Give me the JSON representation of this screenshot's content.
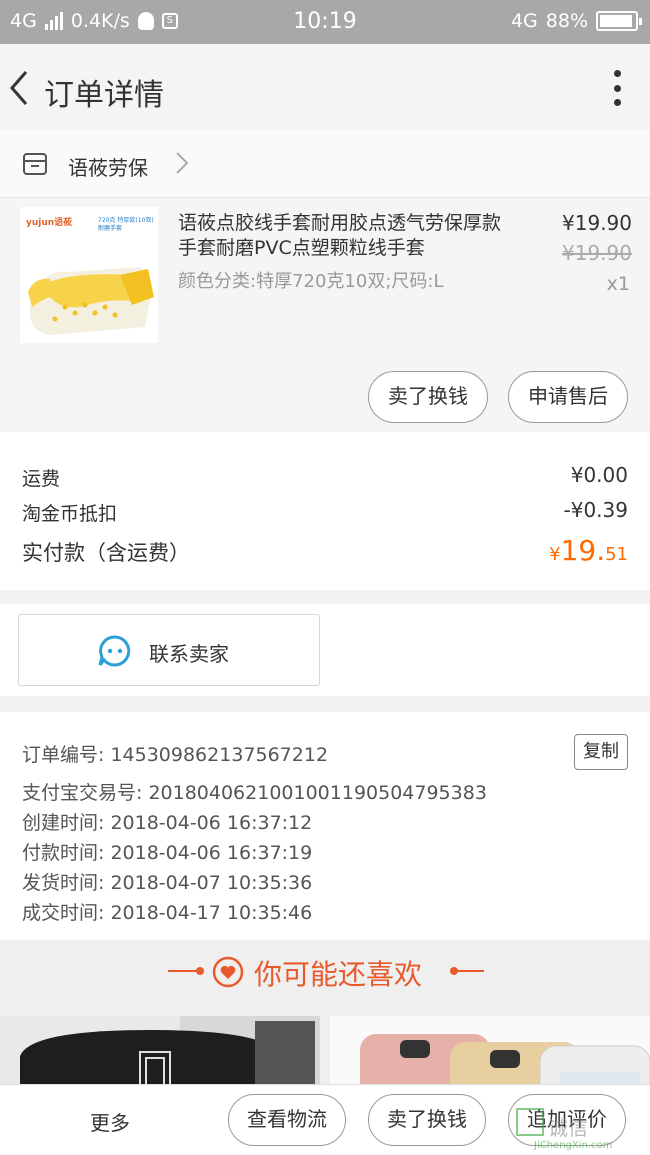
{
  "status_bar": {
    "network": "4G",
    "speed": "0.4K/s",
    "time": "10:19",
    "network_right": "4G",
    "battery": "88%"
  },
  "nav": {
    "title": "订单详情"
  },
  "shop": {
    "name": "语莜劳保"
  },
  "product": {
    "image_brand": "yujun语莜",
    "image_tags": "720克 特厚款(10双)",
    "image_tags2": "耐磨手套",
    "title": "语莜点胶线手套耐用胶点透气劳保厚款手套耐磨PVC点塑颗粒线手套",
    "sku": "颜色分类:特厚720克10双;尺码:L",
    "price": "¥19.90",
    "original_price": "¥19.90",
    "quantity": "x1",
    "actions": [
      "卖了换钱",
      "申请售后"
    ]
  },
  "fees": {
    "shipping_label": "运费",
    "shipping_value": "¥0.00",
    "coin_label": "淘金币抵扣",
    "coin_value": "-¥0.39",
    "total_label": "实付款（含运费）",
    "total_currency": "¥",
    "total_int": "19.",
    "total_dec": "51"
  },
  "contact": {
    "label": "联系卖家"
  },
  "order_info": {
    "order_no": "订单编号: 1453098621375672​12",
    "copy_label": "复制",
    "alipay_no": "支付宝交易号: 2018040621001001190504795383",
    "created": "创建时间: 2018-04-06 16:37:12",
    "paid": "付款时间: 2018-04-06 16:37:19",
    "shipped": "发货时间: 2018-04-07 10:35:36",
    "completed": "成交时间: 2018-04-17 10:35:46"
  },
  "recommend": {
    "title": "你可能还喜欢"
  },
  "bottom_bar": {
    "more": "更多",
    "buttons": [
      "查看物流",
      "卖了换钱",
      "追加评价"
    ]
  },
  "watermark": {
    "text": "诚信",
    "url": "JiChengXin.com"
  },
  "colors": {
    "accent": "#ff6a00",
    "recommend": "#e85a2c",
    "contact_icon": "#2a9fd8"
  }
}
